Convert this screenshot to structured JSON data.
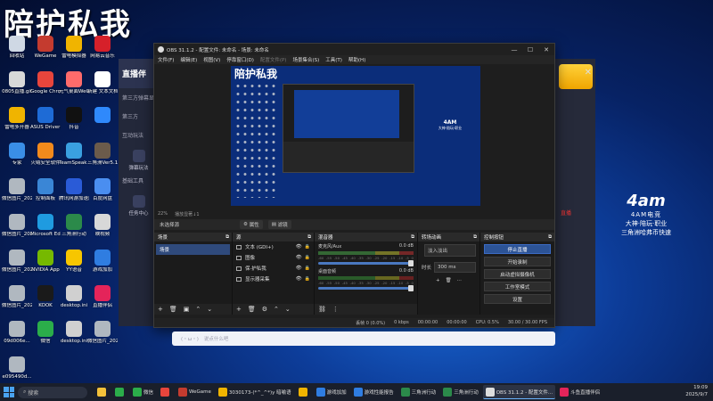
{
  "watermark": "陪护私我",
  "desktop_icons": [
    {
      "label": "回收站",
      "color": "#cfd8e4"
    },
    {
      "label": "WeGame",
      "color": "#c43b2f"
    },
    {
      "label": "雷电模拟器",
      "color": "#f0b400"
    },
    {
      "label": "网易云音乐",
      "color": "#d6202a"
    },
    {
      "label": "0805直播.gif",
      "color": "#d8d8d8"
    },
    {
      "label": "Google Chrome",
      "color": "#e8453c"
    },
    {
      "label": "元气桌面WeGame",
      "color": "#ff6b6b"
    },
    {
      "label": "新建 文本文档.txt",
      "color": "#ffffff"
    },
    {
      "label": "雷电多开器",
      "color": "#f0b400"
    },
    {
      "label": "ASUS DriverHub",
      "color": "#1e6bd6"
    },
    {
      "label": "抖音",
      "color": "#111111"
    },
    {
      "label": "",
      "color": "#2f89fc"
    },
    {
      "label": "专家",
      "color": "#3a8ee6"
    },
    {
      "label": "火绒安全软件",
      "color": "#f28a1c"
    },
    {
      "label": "TeamSpeak 3",
      "color": "#3aa0e0"
    },
    {
      "label": "三角洲Ver5.1",
      "color": "#6b5b4b"
    },
    {
      "label": "微信图片_20250814",
      "color": "#b0b8c0"
    },
    {
      "label": "控制面板",
      "color": "#3a86d6"
    },
    {
      "label": "腾讯网游加速器",
      "color": "#2a5bd7"
    },
    {
      "label": "百度网盘",
      "color": "#4a8ef0"
    },
    {
      "label": "微信图片_20250815",
      "color": "#b0b8c0"
    },
    {
      "label": "Microsoft Edge",
      "color": "#1f9be0"
    },
    {
      "label": "三角洲行动",
      "color": "#2b8a4a"
    },
    {
      "label": "映视频",
      "color": "#d8d8d8"
    },
    {
      "label": "微信图片_20250815",
      "color": "#b0b8c0"
    },
    {
      "label": "NVIDIA App",
      "color": "#76b900"
    },
    {
      "label": "YY语音",
      "color": "#f7c600"
    },
    {
      "label": "游戏加加",
      "color": "#2f7de1"
    },
    {
      "label": "微信图片_20250815",
      "color": "#b0b8c0"
    },
    {
      "label": "KOOK",
      "color": "#1a1a1a"
    },
    {
      "label": "desktop.ini",
      "color": "#d0d0d0"
    },
    {
      "label": "直播伴侣",
      "color": "#e4245a"
    },
    {
      "label": "09d006e...",
      "color": "#b0b8c0"
    },
    {
      "label": "微信",
      "color": "#2bad4a"
    },
    {
      "label": "desktop.ini",
      "color": "#d0d0d0"
    },
    {
      "label": "微信图片_20250815",
      "color": "#b0b8c0"
    },
    {
      "label": "e095490d...",
      "color": "#b0b8c0"
    }
  ],
  "bg_app": {
    "brand": "直播伴",
    "row1": "第三方弹幕显",
    "row2": "第三方",
    "section1": "互动玩法",
    "tool1": "弹幕玩法",
    "section2": "基础工具",
    "tool2": "任务中心"
  },
  "bg_app_right": {
    "red_text": "直播"
  },
  "obs": {
    "title": "OBS 31.1.2 - 配置文件: 未命名 - 场景: 未命名",
    "menu": [
      "文件(F)",
      "编辑(E)",
      "视图(V)",
      "停靠窗口(D)",
      "配置文件(P)",
      "场景集合(S)",
      "工具(T)",
      "帮助(H)"
    ],
    "preview": {
      "watermark": "陪护私我",
      "logo_l1": "4AM",
      "logo_l2": "大神·陪玩·职业"
    },
    "zoom_row": [
      "22%",
      "播放显著↓1"
    ],
    "no_source": "未选择源",
    "props_btn": "属性",
    "filter_btn": "滤镜",
    "docks": {
      "scenes": {
        "title": "场景",
        "items": [
          "场景"
        ]
      },
      "sources": {
        "title": "源",
        "items": [
          {
            "name": "文本 (GDI+)",
            "tag": "(GDI+)"
          },
          {
            "name": "图像",
            "tag": ""
          },
          {
            "name": "保·护私我",
            "tag": ""
          },
          {
            "name": "显示器采集",
            "tag": ""
          }
        ]
      },
      "mixer": {
        "title": "混音器",
        "channels": [
          {
            "name": "麦克风/Aux",
            "db": "0.0 dB"
          },
          {
            "name": "桌面音频",
            "db": "0.0 dB"
          }
        ],
        "scale": [
          "-60",
          "-55",
          "-50",
          "-45",
          "-40",
          "-35",
          "-30",
          "-25",
          "-20",
          "-15",
          "-10",
          "-5",
          "0"
        ]
      },
      "transitions": {
        "title": "转场动画",
        "type": "淡入淡出",
        "duration_label": "时长",
        "duration": "300 ms"
      },
      "controls": {
        "title": "控制按钮",
        "buttons": [
          "停止直播",
          "开始录制",
          "启动虚拟摄像机",
          "工作室模式",
          "设置"
        ]
      }
    },
    "status": [
      "丢帧 0 (0.0%)",
      "0 kbps",
      "00:00:00",
      "00:00:00",
      "CPU: 0.5%",
      "30.00 / 30.00 FPS"
    ]
  },
  "chatbar": {
    "icon": "(・ω・)",
    "text": "说点什么吧"
  },
  "right_brand": {
    "l1": "4am",
    "l2": "4AM电竞",
    "l3": "大神·陪玩·职业",
    "l4": "三角洲哈弗币快速"
  },
  "taskbar": {
    "search": "搜索",
    "items": [
      {
        "label": "",
        "color": "#f3c13a"
      },
      {
        "label": "",
        "color": "#2bad4a"
      },
      {
        "label": "微信",
        "color": "#2bad4a"
      },
      {
        "label": "",
        "color": "#e8453c"
      },
      {
        "label": "WeGame",
        "color": "#c43b2f"
      },
      {
        "label": "3030173-(*^_^*)y 暗喻语",
        "color": "#f0b400"
      },
      {
        "label": "",
        "color": "#f0b400"
      },
      {
        "label": "游戏加加",
        "color": "#2f7de1"
      },
      {
        "label": "游戏性能报告",
        "color": "#2f7de1"
      },
      {
        "label": "三角洲行动",
        "color": "#2b8a4a"
      },
      {
        "label": "三角洲行动",
        "color": "#2b8a4a"
      },
      {
        "label": "OBS 31.1.2 - 配置文件...",
        "color": "#dddddd"
      },
      {
        "label": "斗鱼直播伴侣",
        "color": "#e4245a"
      }
    ],
    "time": "19:09",
    "date": "2025/9/7"
  }
}
